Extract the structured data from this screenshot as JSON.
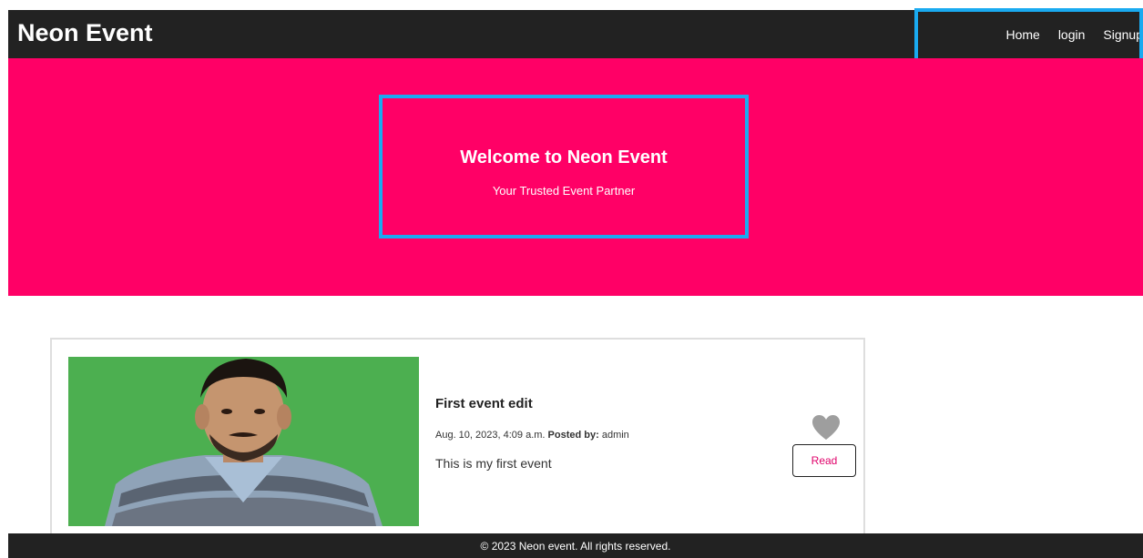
{
  "header": {
    "brand": "Neon Event",
    "nav": [
      {
        "label": "Home"
      },
      {
        "label": "login"
      },
      {
        "label": "Signup"
      }
    ]
  },
  "hero": {
    "title": "Welcome to Neon Event",
    "subtitle": "Your Trusted Event Partner"
  },
  "event": {
    "title": "First event edit",
    "date": "Aug. 10, 2023, 4:09 a.m.",
    "posted_by_label": "Posted by:",
    "author": "admin",
    "description": "This is my first event",
    "read_label": "Read"
  },
  "footer": {
    "text": "© 2023 Neon event. All rights reserved."
  },
  "colors": {
    "nav_bg": "#222222",
    "hero_bg": "#ff0066",
    "highlight": "#1aaaf0",
    "image_bg": "#4caf50",
    "read_text": "#e0006a"
  }
}
